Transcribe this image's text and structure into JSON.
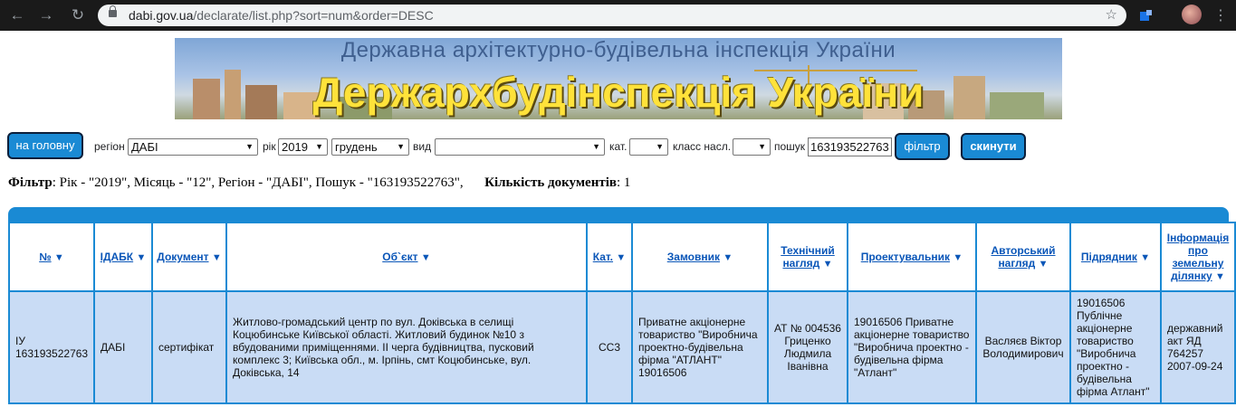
{
  "browser": {
    "url_host": "dabi.gov.ua",
    "url_path": "/declarate/list.php?sort=num&order=DESC"
  },
  "banner": {
    "subtitle": "Державна архітектурно-будівельна інспекція України",
    "title": "Держархбудінспекція України"
  },
  "form": {
    "home_label": "на головну",
    "region_label": "регіон",
    "region_value": "ДАБІ",
    "year_label": "рік",
    "year_value": "2019",
    "month_value": "грудень",
    "type_label": "вид",
    "type_value": "",
    "cat_label": "кат.",
    "cat_value": "",
    "class_label": "класс насл.",
    "class_value": "",
    "search_label": "пошук",
    "search_value": "163193522763",
    "filter_label": "фільтр",
    "reset_label": "скинути"
  },
  "summary": {
    "filter_label": "Фільтр",
    "filter_text": ": Рік - \"2019\", Місяць - \"12\", Регіон - \"ДАБІ\", Пошук - \"163193522763\",",
    "count_label": "Кількість документів",
    "count_value": ": 1"
  },
  "table": {
    "headers": [
      "№",
      "ІДАБК",
      "Документ",
      "Об`єкт",
      "Кат.",
      "Замовник",
      "Технічний нагляд",
      "Проектувальник",
      "Авторський нагляд",
      "Підрядник",
      "Інформація про земельну ділянку"
    ],
    "rows": [
      {
        "num": "ІУ 163193522763",
        "idabk": "ДАБІ",
        "doc": "сертифікат",
        "object": "Житлово-громадський центр по вул. Доківська в селищі Коцюбинське Київської області. Житловий будинок №10 з вбудованими приміщеннями. ІІ черга будівництва, пусковий комплекс 3; Київська обл., м. Ірпінь, смт Коцюбинське, вул. Доківська, 14",
        "cat": "СС3",
        "customer": "Приватне акціонерне товариство \"Виробнича проектно-будівельна фірма \"АТЛАНТ\" 19016506",
        "tech": "АТ № 004536 Гриценко Людмила Іванівна",
        "designer": "19016506 Приватне акціонерне товариство \"Виробнича проектно - будівельна фірма \"Атлант\"",
        "author": "Васляєв Віктор Володимирович",
        "contractor": "19016506 Публічне акціонерне товариство \"Виробнича проектно - будівельна фірма Атлант\"",
        "land": "державний акт ЯД 764257 2007-09-24"
      }
    ]
  }
}
